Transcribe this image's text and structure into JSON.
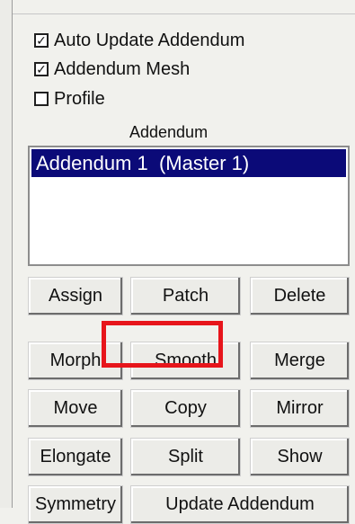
{
  "checkboxes": [
    {
      "label": "Auto Update Addendum",
      "checked": true
    },
    {
      "label": "Addendum Mesh",
      "checked": true
    },
    {
      "label": "Profile",
      "checked": false
    }
  ],
  "section": {
    "title": "Addendum"
  },
  "list": {
    "items": [
      "Addendum 1  (Master 1)"
    ]
  },
  "buttons": {
    "assign": "Assign",
    "patch": "Patch",
    "delete": "Delete",
    "morph": "Morph",
    "smooth": "Smooth",
    "merge": "Merge",
    "move": "Move",
    "copy": "Copy",
    "mirror": "Mirror",
    "elongate": "Elongate",
    "split": "Split",
    "show": "Show",
    "symmetry": "Symmetry",
    "update_addendum": "Update Addendum"
  },
  "colors": {
    "selection": "#0b0a78",
    "highlight": "#e7151b"
  },
  "icons": {
    "checked": "checkmark-icon"
  }
}
